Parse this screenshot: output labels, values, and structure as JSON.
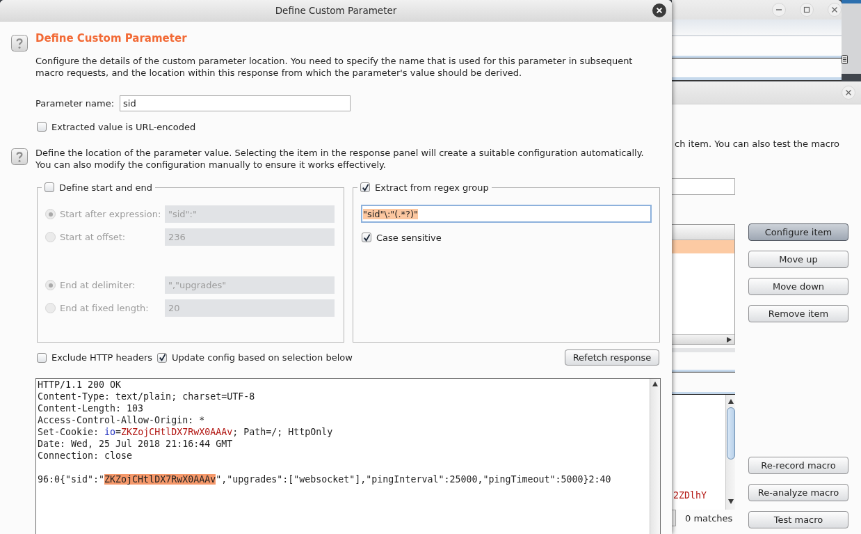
{
  "dialog": {
    "title": "Define Custom Parameter",
    "heading": "Define Custom Parameter",
    "intro": "Configure the details of the custom parameter location. You need to specify the name that is used for this parameter in subsequent macro requests, and the location within this response from which the parameter's value should be derived.",
    "parameter_name": {
      "label": "Parameter name:",
      "value": "sid"
    },
    "url_encoded": {
      "label": "Extracted value is URL-encoded",
      "checked": false
    },
    "location_help": "Define the location of the parameter value. Selecting the item in the response panel will create a suitable configuration automatically. You can also modify the configuration manually to ensure it works effectively.",
    "start_end": {
      "label": "Define start and end",
      "checked": false,
      "start_options": [
        {
          "label": "Start after expression:",
          "selected": true,
          "value": "\"sid\":\""
        },
        {
          "label": "Start at offset:",
          "selected": false,
          "value": "236"
        }
      ],
      "end_options": [
        {
          "label": "End at delimiter:",
          "selected": true,
          "value": "\",\"upgrades\""
        },
        {
          "label": "End at fixed length:",
          "selected": false,
          "value": "20"
        }
      ]
    },
    "regex": {
      "label": "Extract from regex group",
      "checked": true,
      "field": {
        "value": "\"sid\"\\:\"(.*?)\"",
        "focused": true,
        "text_selected": true
      },
      "case_sensitive": {
        "label": "Case sensitive",
        "checked": true
      }
    },
    "options": [
      {
        "label": "Exclude HTTP headers",
        "checked": false
      },
      {
        "label": "Update config based on selection below",
        "checked": true
      }
    ],
    "refetch_button": "Refetch response",
    "response": {
      "headers": [
        [
          {
            "kind": "plain",
            "text": "HTTP/1.1 200 OK"
          }
        ],
        [
          {
            "kind": "plain",
            "text": "Content-Type: text/plain; charset=UTF-8"
          }
        ],
        [
          {
            "kind": "plain",
            "text": "Content-Length: 103"
          }
        ],
        [
          {
            "kind": "plain",
            "text": "Access-Control-Allow-Origin: *"
          }
        ],
        [
          {
            "kind": "plain",
            "text": "Set-Cookie: "
          },
          {
            "kind": "cookie_name",
            "text": "io"
          },
          {
            "kind": "plain",
            "text": "="
          },
          {
            "kind": "cookie_value",
            "text": "ZKZojCHtlDX7RwX0AAAv"
          },
          {
            "kind": "plain",
            "text": "; Path=/; HttpOnly"
          }
        ],
        [
          {
            "kind": "plain",
            "text": "Date: Wed, 25 Jul 2018 21:16:44 GMT"
          }
        ],
        [
          {
            "kind": "plain",
            "text": "Connection: close"
          }
        ]
      ],
      "body": [
        [
          {
            "kind": "plain",
            "text": "96:0{\"sid\":\""
          },
          {
            "kind": "selected",
            "text": "ZKZojCHtlDX7RwX0AAAv"
          },
          {
            "kind": "plain",
            "text": "\",\"upgrades\":[\"websocket\"],\"pingInterval\":25000,\"pingTimeout\":5000}2:40"
          }
        ]
      ]
    }
  },
  "macro_window": {
    "instructions": "ch item. You can also test the macro",
    "table": {
      "rows": [
        {
          "selected": true
        }
      ]
    },
    "item_buttons": [
      {
        "label": "Configure item",
        "default": true
      },
      {
        "label": "Move up",
        "default": false
      },
      {
        "label": "Move down",
        "default": false
      },
      {
        "label": "Remove item",
        "default": false
      }
    ],
    "response_fragment": "2ZDlhY",
    "match_count": "0 matches",
    "macro_buttons": [
      "Re-record macro",
      "Re-analyze macro",
      "Test macro"
    ]
  }
}
